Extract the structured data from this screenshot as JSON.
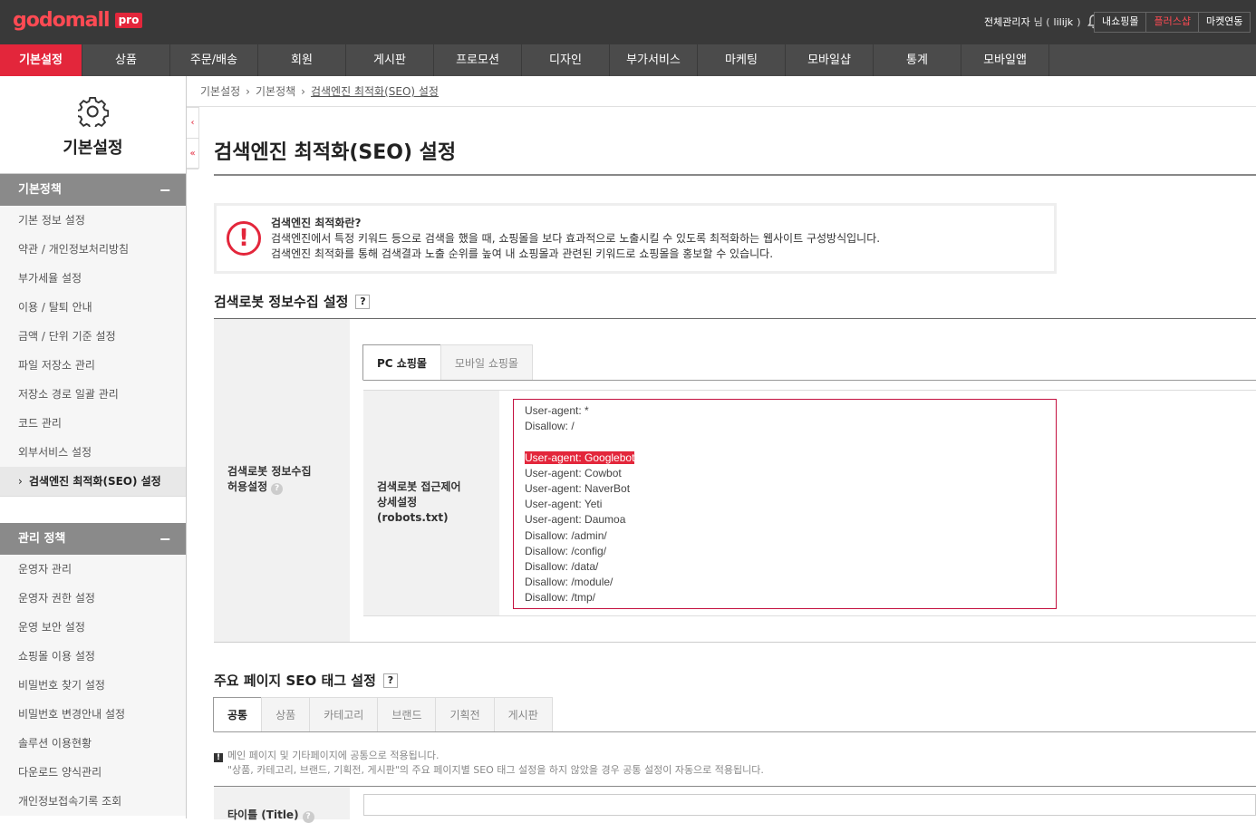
{
  "topbar": {
    "logo": "godomall",
    "logo_badge": "pro",
    "admin_name": "전체관리자",
    "admin_suffix": "님 (",
    "admin_id": "lilijk",
    "admin_close": ")",
    "buttons": [
      "내쇼핑몰",
      "플러스샵",
      "마켓연동"
    ]
  },
  "gnb": [
    "기본설정",
    "상품",
    "주문/배송",
    "회원",
    "게시판",
    "프로모션",
    "디자인",
    "부가서비스",
    "마케팅",
    "모바일샵",
    "통계",
    "모바일앱"
  ],
  "lnb": {
    "title": "기본설정",
    "sections": [
      {
        "title": "기본정책",
        "items": [
          "기본 정보 설정",
          "약관 / 개인정보처리방침",
          "부가세율 설정",
          "이용 / 탈퇴 안내",
          "금액 / 단위 기준 설정",
          "파일 저장소 관리",
          "저장소 경로 일괄 관리",
          "코드 관리",
          "외부서비스 설정",
          "검색엔진 최적화(SEO) 설정"
        ]
      },
      {
        "title": "관리 정책",
        "items": [
          "운영자 관리",
          "운영자 권한 설정",
          "운영 보안 설정",
          "쇼핑몰 이용 설정",
          "비밀번호 찾기 설정",
          "비밀번호 변경안내 설정",
          "솔루션 이용현황",
          "다운로드 양식관리",
          "개인정보접속기록 조회"
        ]
      }
    ]
  },
  "breadcrumb": [
    "기본설정",
    "기본정책",
    "검색엔진 최적화(SEO) 설정"
  ],
  "page_title": "검색엔진 최적화(SEO) 설정",
  "notice": {
    "head": "검색엔진 최적화란?",
    "line1": "검색엔진에서 특정 키워드 등으로 검색을 했을 때, 쇼핑몰을 보다 효과적으로 노출시킬 수 있도록 최적화하는 웹사이트 구성방식입니다.",
    "line2": "검색엔진 최적화를 통해 검색결과 노출 순위를 높여 내 쇼핑몰과 관련된 키워드로 쇼핑몰을 홍보할 수 있습니다."
  },
  "robot_section": {
    "title": "검색로봇 정보수집 설정",
    "help": "?",
    "row_label_1": "검색로봇 정보수집",
    "row_label_2": "허용설정",
    "tabs": [
      "PC 쇼핑몰",
      "모바일 쇼핑몰"
    ],
    "inner_label_1": "검색로봇 접근제어",
    "inner_label_2": "상세설정",
    "inner_label_3": "(robots.txt)",
    "robots_lines": [
      "User-agent: *",
      "Disallow: /",
      "",
      "User-agent: Googlebot",
      "User-agent: Cowbot",
      "User-agent: NaverBot",
      "User-agent: Yeti",
      "User-agent: Daumoa",
      "Disallow: /admin/",
      "Disallow: /config/",
      "Disallow: /data/",
      "Disallow: /module/",
      "Disallow: /tmp/"
    ]
  },
  "seo_section": {
    "title": "주요 페이지 SEO 태그 설정",
    "help": "?",
    "tabs": [
      "공통",
      "상품",
      "카테고리",
      "브랜드",
      "기획전",
      "게시판"
    ],
    "info_line1": "메인 페이지 및 기타페이지에 공통으로 적용됩니다.",
    "info_line2": "\"상품, 카테고리, 브랜드, 기획전, 게시판\"의 주요 페이지별 SEO 태그 설정을 하지 않았을 경우 공통 설정이 자동으로 적용됩니다.",
    "title_label": "타이틀 (Title)"
  },
  "colors": {
    "accent": "#e3263b",
    "topbar": "#393939",
    "gnb": "#4b4b4b"
  }
}
